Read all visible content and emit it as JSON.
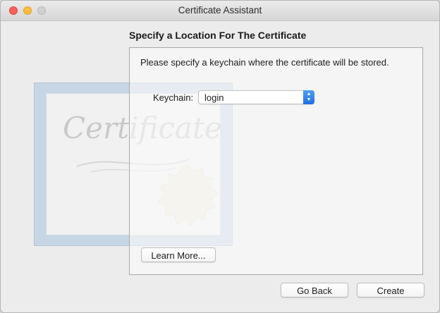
{
  "window": {
    "title": "Certificate Assistant"
  },
  "heading": "Specify a Location For The Certificate",
  "panel": {
    "instruction": "Please specify a keychain where the certificate will be stored.",
    "keychain_label": "Keychain:",
    "keychain_value": "login"
  },
  "buttons": {
    "learn_more": "Learn More...",
    "go_back": "Go Back",
    "create": "Create"
  },
  "decoration": {
    "certificate_word": "Certificate"
  },
  "colors": {
    "accent": "#1f6fe0",
    "close": "#fc605c",
    "minimize": "#fdbc40"
  }
}
